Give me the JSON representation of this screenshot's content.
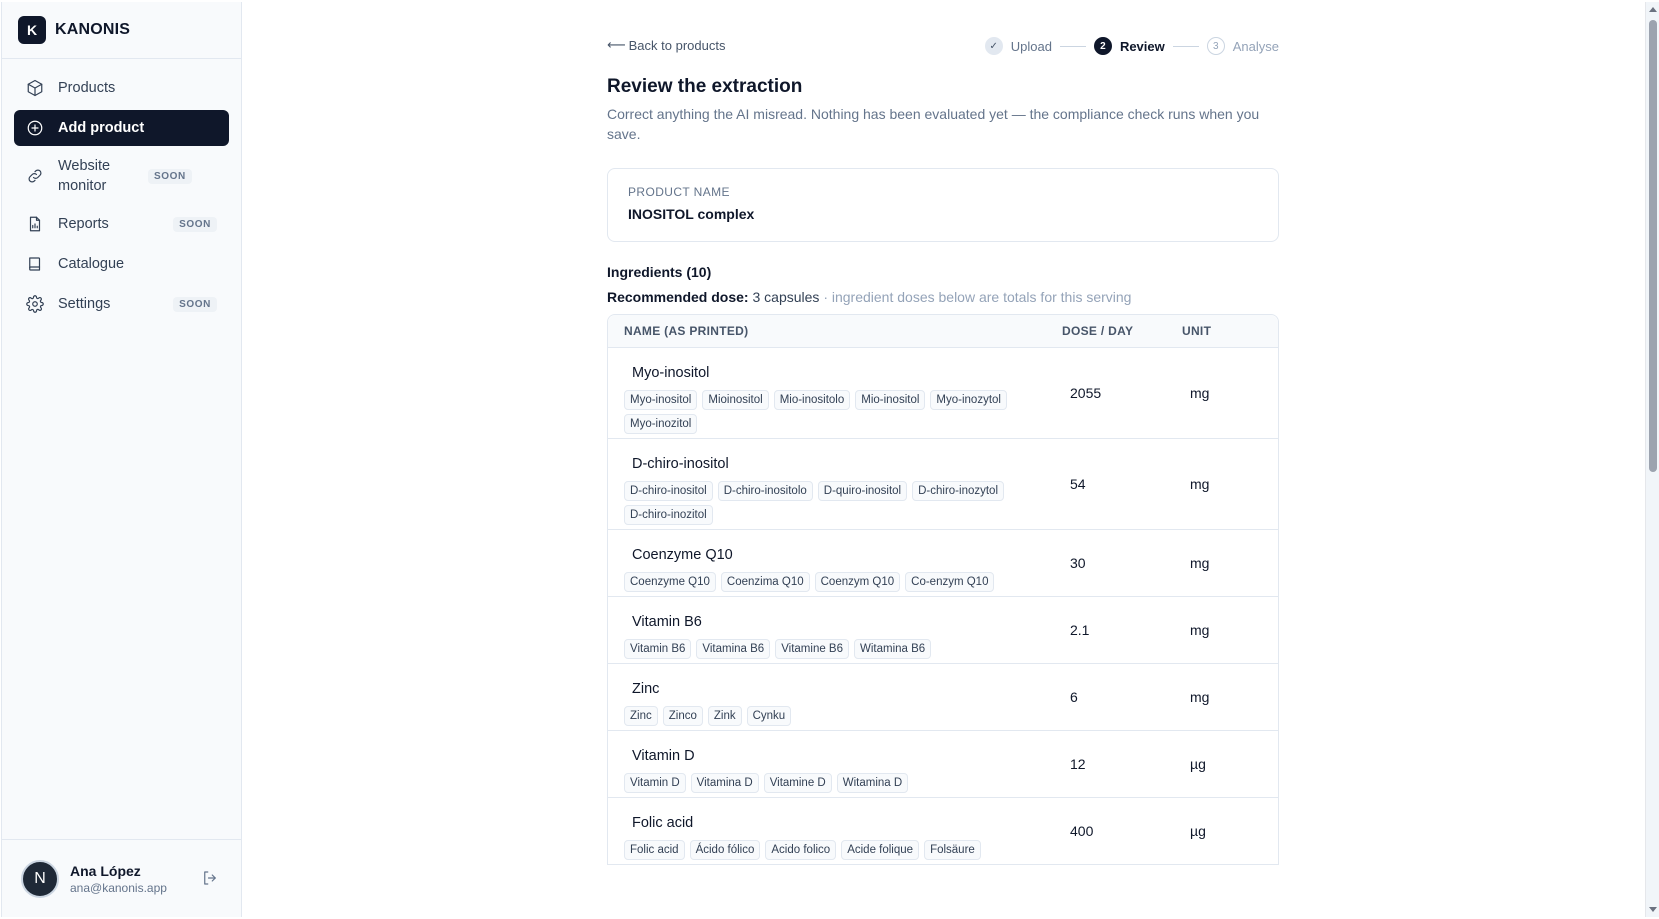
{
  "brand": {
    "mark": "K",
    "name": "KANONIS"
  },
  "sidebar": {
    "items": [
      {
        "label": "Products",
        "icon": "box-icon",
        "soon": ""
      },
      {
        "label": "Add product",
        "icon": "plus-circle-icon",
        "soon": "",
        "active": true
      },
      {
        "label": "Website monitor",
        "icon": "link-icon",
        "soon": "SOON"
      },
      {
        "label": "Reports",
        "icon": "report-icon",
        "soon": "SOON"
      },
      {
        "label": "Catalogue",
        "icon": "book-icon",
        "soon": ""
      },
      {
        "label": "Settings",
        "icon": "gear-icon",
        "soon": "SOON"
      }
    ]
  },
  "user": {
    "initial": "N",
    "name": "Ana López",
    "email": "ana@kanonis.app"
  },
  "topbar": {
    "back_label": "Back to products",
    "steps": [
      {
        "num": "✓",
        "label": "Upload",
        "state": "done"
      },
      {
        "num": "2",
        "label": "Review",
        "state": "current"
      },
      {
        "num": "3",
        "label": "Analyse",
        "state": "upcoming"
      }
    ]
  },
  "page": {
    "title": "Review the extraction",
    "subtitle": "Correct anything the AI misread. Nothing has been evaluated yet — the compliance check runs when you save."
  },
  "product": {
    "label": "PRODUCT NAME",
    "value": "INOSITOL complex"
  },
  "ingredients": {
    "heading": "Ingredients (10)",
    "dose_label": "Recommended dose:",
    "dose_value": "3 capsules",
    "dose_hint": "· ingredient doses below are totals for this serving",
    "columns": {
      "name": "NAME (AS PRINTED)",
      "dose": "DOSE / DAY",
      "unit": "UNIT"
    },
    "rows": [
      {
        "name": "Myo-inositol",
        "dose": "2055",
        "unit": "mg",
        "aliases": [
          "Myo-inositol",
          "Mioinositol",
          "Mio-inositolo",
          "Mio-inositol",
          "Myo-inozytol",
          "Myo-inozitol"
        ]
      },
      {
        "name": "D-chiro-inositol",
        "dose": "54",
        "unit": "mg",
        "aliases": [
          "D-chiro-inositol",
          "D-chiro-inositolo",
          "D-quiro-inositol",
          "D-chiro-inozytol",
          "D-chiro-inozitol"
        ]
      },
      {
        "name": "Coenzyme Q10",
        "dose": "30",
        "unit": "mg",
        "aliases": [
          "Coenzyme Q10",
          "Coenzima Q10",
          "Coenzym Q10",
          "Co-enzym Q10"
        ]
      },
      {
        "name": "Vitamin B6",
        "dose": "2.1",
        "unit": "mg",
        "aliases": [
          "Vitamin B6",
          "Vitamina B6",
          "Vitamine B6",
          "Witamina B6"
        ]
      },
      {
        "name": "Zinc",
        "dose": "6",
        "unit": "mg",
        "aliases": [
          "Zinc",
          "Zinco",
          "Zink",
          "Cynku"
        ]
      },
      {
        "name": "Vitamin D",
        "dose": "12",
        "unit": "µg",
        "aliases": [
          "Vitamin D",
          "Vitamina D",
          "Vitamine D",
          "Witamina D"
        ]
      },
      {
        "name": "Folic acid",
        "dose": "400",
        "unit": "µg",
        "aliases": [
          "Folic acid",
          "Ácido fólico",
          "Acido folico",
          "Acide folique",
          "Folsäure"
        ]
      }
    ]
  }
}
